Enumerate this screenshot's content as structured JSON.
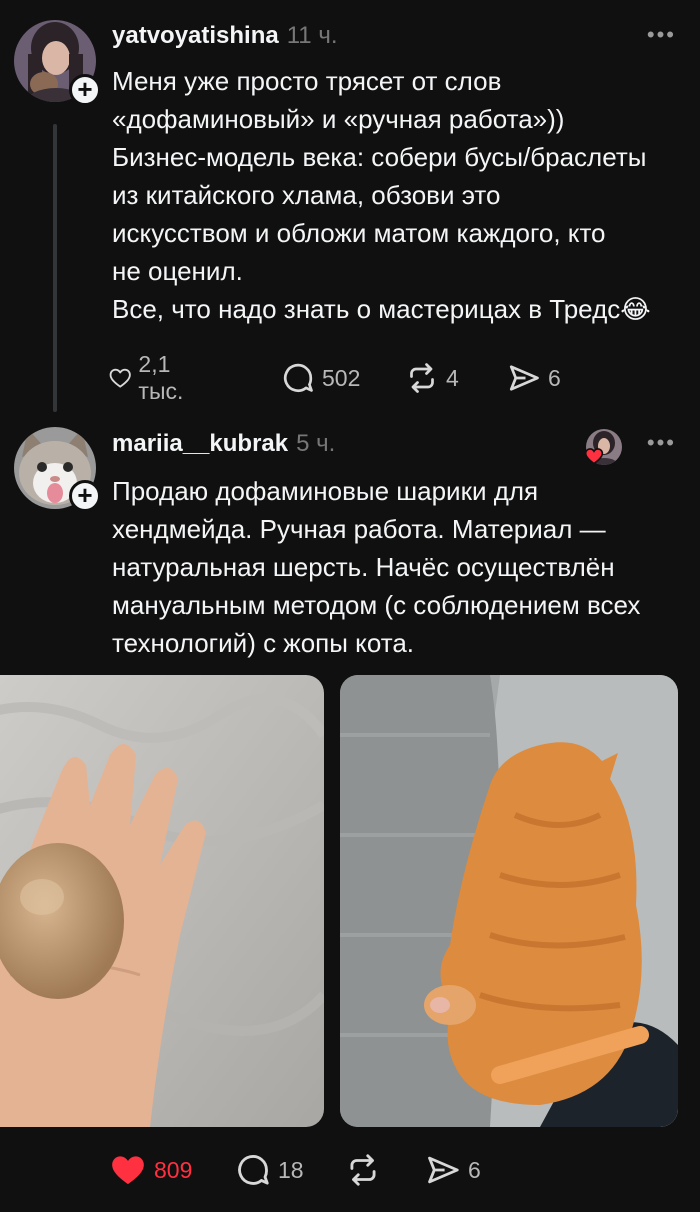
{
  "posts": [
    {
      "username": "yatvoyatishina",
      "time": "11 ч.",
      "more_label": "•••",
      "lines": [
        "Меня уже просто трясет от слов",
        "«дофаминовый» и «ручная работа»))",
        "Бизнес-модель века: собери бусы/браслеты",
        "из китайского хлама, обзови это",
        "искусством и обложи матом каждого, кто",
        "не оценил.",
        "Все, что надо знать о мастерицах в Тредс😂"
      ],
      "actions": {
        "likes": "2,1 тыс.",
        "replies": "502",
        "reposts": "4",
        "shares": "6",
        "liked": false
      }
    },
    {
      "username": "mariia__kubrak",
      "time": "5 ч.",
      "more_label": "•••",
      "lines": [
        "Продаю дофаминовые шарики для",
        "хендмейда. Ручная работа. Материал —",
        "натуральная шерсть. Начёс осуществлён",
        "мануальным методом (с соблюдением всех",
        "технологий) с жопы кота."
      ],
      "actions": {
        "likes": "809",
        "replies": "18",
        "reposts": "",
        "shares": "6",
        "liked": true
      }
    }
  ],
  "colors": {
    "background": "#101010",
    "text": "#f3f5f7",
    "muted": "#777777",
    "like_red": "#ff3040"
  },
  "icons": [
    "plus-icon",
    "more-icon",
    "heart-icon",
    "comment-icon",
    "repost-icon",
    "share-icon"
  ]
}
